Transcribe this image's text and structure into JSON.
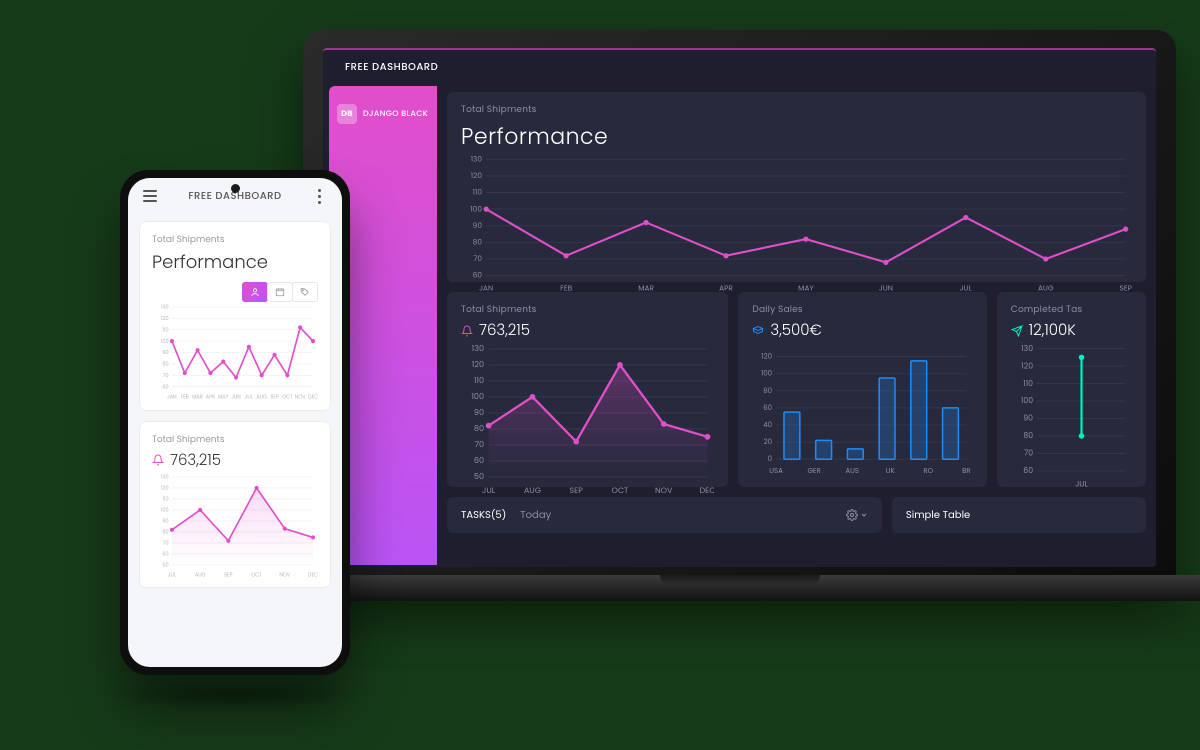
{
  "app": {
    "title": "FREE DASHBOARD"
  },
  "sidebar": {
    "badge": "DB",
    "label": "DJANGO BLACK"
  },
  "perf": {
    "sub": "Total Shipments",
    "title": "Performance"
  },
  "shipments": {
    "sub": "Total Shipments",
    "value": "763,215"
  },
  "sales": {
    "sub": "Daily Sales",
    "value": "3,500€"
  },
  "tasks_card": {
    "sub": "Completed Tas",
    "value": "12,100K"
  },
  "tasks_bar": {
    "title": "TASKS(5)",
    "tab": "Today"
  },
  "simple_table": {
    "title": "Simple Table"
  },
  "phone": {
    "title": "FREE DASHBOARD",
    "perf": {
      "sub": "Total Shipments",
      "title": "Performance"
    },
    "shipments": {
      "sub": "Total Shipments",
      "value": "763,215"
    }
  },
  "chart_data": [
    {
      "id": "desktop_performance",
      "type": "line",
      "title": "Performance",
      "subtitle": "Total Shipments",
      "ylabel": "",
      "ylim": [
        60,
        130
      ],
      "yticks": [
        60,
        70,
        80,
        90,
        100,
        110,
        120,
        130
      ],
      "categories": [
        "JAN",
        "FEB",
        "MAR",
        "APR",
        "MAY",
        "JUN",
        "JUL",
        "AUG",
        "SEP"
      ],
      "series": [
        {
          "name": "Shipments",
          "color": "#e14eca",
          "values": [
            100,
            72,
            92,
            72,
            82,
            68,
            95,
            70,
            88
          ]
        }
      ]
    },
    {
      "id": "desktop_shipments_small",
      "type": "area",
      "title": "Total Shipments",
      "kpi": "763,215",
      "ylim": [
        50,
        130
      ],
      "yticks": [
        50,
        60,
        70,
        80,
        90,
        100,
        110,
        120,
        130
      ],
      "categories": [
        "JUL",
        "AUG",
        "SEP",
        "OCT",
        "NOV",
        "DEC"
      ],
      "series": [
        {
          "name": "Shipments",
          "color": "#e14eca",
          "values": [
            82,
            100,
            72,
            120,
            83,
            75
          ]
        }
      ]
    },
    {
      "id": "desktop_daily_sales",
      "type": "bar",
      "title": "Daily Sales",
      "kpi": "3,500€",
      "ylim": [
        0,
        130
      ],
      "yticks": [
        0,
        20,
        40,
        60,
        80,
        100,
        120
      ],
      "categories": [
        "USA",
        "GER",
        "AUS",
        "UK",
        "RO",
        "BR"
      ],
      "series": [
        {
          "name": "Sales",
          "color": "#1d8cf8",
          "values": [
            55,
            22,
            12,
            95,
            115,
            60
          ]
        }
      ]
    },
    {
      "id": "desktop_completed_tasks",
      "type": "line",
      "title": "Completed Tasks",
      "kpi": "12,100K",
      "ylim": [
        60,
        130
      ],
      "yticks": [
        60,
        70,
        80,
        90,
        100,
        110,
        120,
        130
      ],
      "categories": [
        "JUL"
      ],
      "series": [
        {
          "name": "Tasks",
          "color": "#00f2c3",
          "values": [
            125,
            80
          ]
        }
      ]
    },
    {
      "id": "phone_performance",
      "type": "line",
      "title": "Performance",
      "subtitle": "Total Shipments",
      "ylim": [
        60,
        130
      ],
      "yticks": [
        60,
        70,
        80,
        90,
        100,
        110,
        120,
        130
      ],
      "categories": [
        "JAN",
        "FEB",
        "MAR",
        "APR",
        "MAY",
        "JUN",
        "JUL",
        "AUG",
        "SEP",
        "OCT",
        "NOV",
        "DEC"
      ],
      "series": [
        {
          "name": "Shipments",
          "color": "#e14eca",
          "values": [
            100,
            72,
            92,
            72,
            82,
            68,
            95,
            70,
            88,
            70,
            112,
            100
          ]
        }
      ]
    },
    {
      "id": "phone_shipments_small",
      "type": "area",
      "title": "Total Shipments",
      "kpi": "763,215",
      "ylim": [
        50,
        130
      ],
      "yticks": [
        50,
        60,
        70,
        80,
        90,
        100,
        110,
        120,
        130
      ],
      "categories": [
        "JUL",
        "AUG",
        "SEP",
        "OCT",
        "NOV",
        "DEC"
      ],
      "series": [
        {
          "name": "Shipments",
          "color": "#e14eca",
          "values": [
            82,
            100,
            72,
            120,
            83,
            75
          ]
        }
      ]
    }
  ]
}
